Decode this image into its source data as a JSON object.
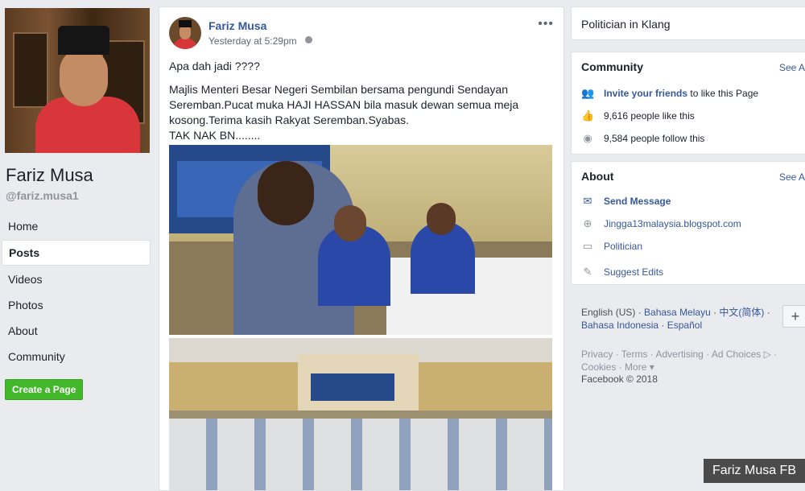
{
  "page": {
    "name": "Fariz Musa",
    "handle": "@fariz.musa1"
  },
  "nav": {
    "items": [
      "Home",
      "Posts",
      "Videos",
      "Photos",
      "About",
      "Community"
    ],
    "active": "Posts",
    "create_page": "Create a Page"
  },
  "post": {
    "author": "Fariz Musa",
    "time": "Yesterday at 5:29pm",
    "more": "•••",
    "lines": [
      "Apa dah jadi ????",
      "Majlis Menteri Besar Negeri Sembilan bersama pengundi Sendayan Seremban.Pucat muka HAJI HASSAN bila masuk dewan semua meja kosong.Terima kasih Rakyat Seremban.Syabas.",
      "TAK NAK BN........"
    ]
  },
  "right": {
    "category": "Politician in Klang",
    "community": {
      "title": "Community",
      "see_all": "See All",
      "invite_link": "Invite your friends",
      "invite_rest": " to like this Page",
      "likes": "9,616 people like this",
      "follows": "9,584 people follow this"
    },
    "about": {
      "title": "About",
      "see_all": "See All",
      "send_message": "Send Message",
      "website": "Jingga13malaysia.blogspot.com",
      "category": "Politician",
      "suggest": "Suggest Edits"
    },
    "languages": {
      "current": "English (US)",
      "sep": " · ",
      "options": [
        "Bahasa Melayu",
        "中文(简体)",
        "Bahasa Indonesia",
        "Español"
      ],
      "plus": "+"
    },
    "footer": {
      "links": [
        "Privacy",
        "Terms",
        "Advertising",
        "Ad Choices ▷",
        "Cookies",
        "More ▾"
      ],
      "copyright": "Facebook © 2018"
    }
  },
  "watermark": "Fariz Musa FB",
  "icons": {
    "invite": "people-icon",
    "likes": "thumbs-up-icon",
    "follows": "rss-icon",
    "message": "messenger-icon",
    "website": "globe-icon",
    "category": "briefcase-icon",
    "suggest": "pencil-icon"
  }
}
